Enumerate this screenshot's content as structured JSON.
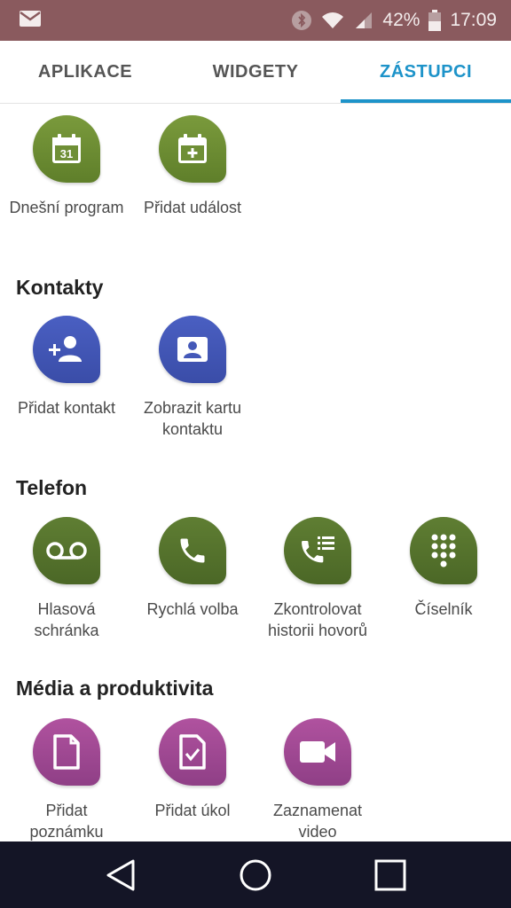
{
  "status_bar": {
    "battery_percent": "42%",
    "time": "17:09",
    "icons": [
      "mail-icon",
      "bluetooth-icon",
      "wifi-icon",
      "signal-icon",
      "battery-icon"
    ]
  },
  "tabs": [
    {
      "label": "APLIKACE",
      "active": false
    },
    {
      "label": "WIDGETY",
      "active": false
    },
    {
      "label": "ZÁSTUPCI",
      "active": true
    }
  ],
  "top_items": [
    {
      "label": "Dnešní program",
      "icon": "calendar-31-icon"
    },
    {
      "label": "Přidat událost",
      "icon": "calendar-add-icon"
    }
  ],
  "contacts": {
    "title": "Kontakty",
    "items": [
      {
        "label": "Přidat kontakt",
        "icon": "add-person-icon"
      },
      {
        "label_line1": "Zobrazit kartu",
        "label_line2": "kontaktu",
        "icon": "contact-card-icon"
      }
    ]
  },
  "phone": {
    "title": "Telefon",
    "items": [
      {
        "label_line1": "Hlasová",
        "label_line2": "schránka",
        "icon": "voicemail-icon"
      },
      {
        "label": "Rychlá volba",
        "icon": "phone-icon"
      },
      {
        "label_line1": "Zkontrolovat",
        "label_line2": "historii hovorů",
        "icon": "call-log-icon"
      },
      {
        "label": "Číselník",
        "icon": "dialpad-icon"
      }
    ]
  },
  "media": {
    "title": "Média a produktivita",
    "items": [
      {
        "label_line1": "Přidat",
        "label_line2": "poznámku",
        "icon": "note-icon"
      },
      {
        "label": "Přidat úkol",
        "icon": "task-icon"
      },
      {
        "label_line1": "Zaznamenat",
        "label_line2": "video",
        "icon": "video-camera-icon"
      }
    ]
  },
  "colors": {
    "accent": "#1d93c9",
    "status_bar": "#8a5a5e",
    "calendar_green": "#6f8f36",
    "phone_olive": "#56732c",
    "contacts_blue": "#4458b8",
    "media_purple": "#a04994",
    "nav_bar": "#141526"
  },
  "nav_bar": {
    "buttons": [
      "back-icon",
      "home-icon",
      "recents-icon"
    ]
  }
}
